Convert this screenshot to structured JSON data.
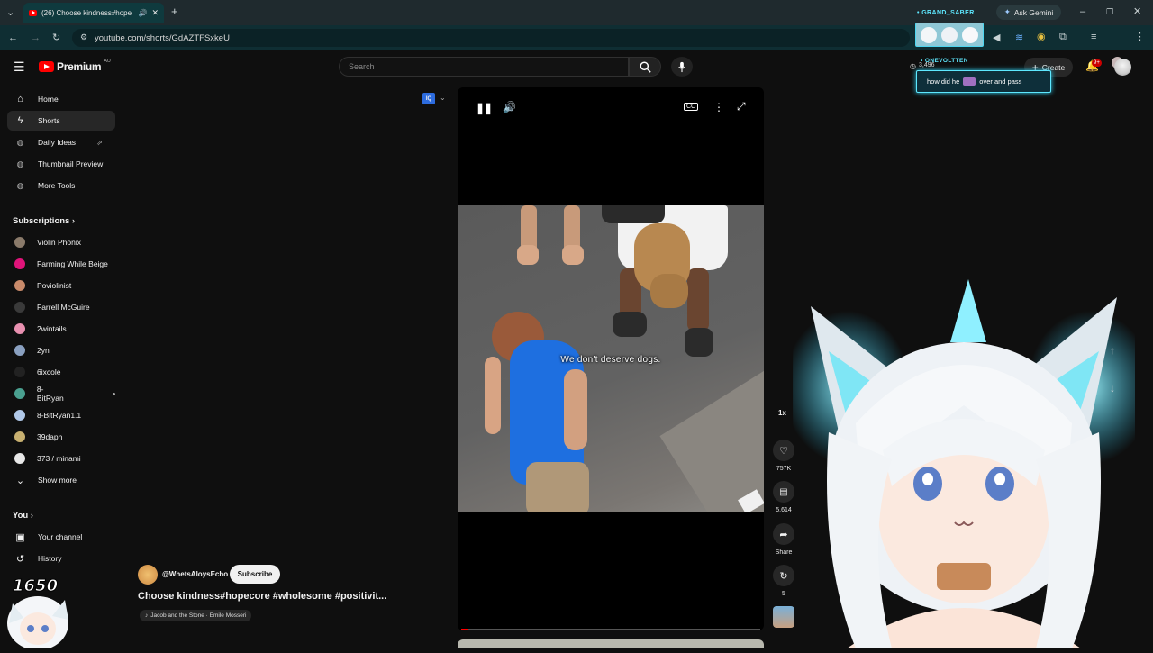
{
  "browser": {
    "tab_title": "(26) Choose kindness#hope",
    "url": "youtube.com/shorts/GdAZTFSxkeU",
    "ask_gemini": "Ask Gemini"
  },
  "header": {
    "logo_text": "Premium",
    "logo_region": "AU",
    "search_placeholder": "Search",
    "create_label": "Create",
    "notif_badge": "9+",
    "overlay_counter": "3,496"
  },
  "sidebar": {
    "nav": [
      {
        "label": "Home",
        "icon": "home-icon",
        "active": false
      },
      {
        "label": "Shorts",
        "icon": "shorts-icon",
        "active": true
      },
      {
        "label": "Daily Ideas",
        "icon": "extension-icon",
        "active": false
      },
      {
        "label": "Thumbnail Preview",
        "icon": "extension-icon",
        "active": false
      },
      {
        "label": "More Tools",
        "icon": "extension-icon",
        "active": false
      }
    ],
    "subscriptions_title": "Subscriptions",
    "subscriptions": [
      {
        "label": "Violin Phonix",
        "color": "#8a7a6a"
      },
      {
        "label": "Farming While Beige",
        "color": "#e0147a"
      },
      {
        "label": "Poviolinist",
        "color": "#c98a6a"
      },
      {
        "label": "Farrell McGuire",
        "color": "#3a3a3a"
      },
      {
        "label": "2wintails",
        "color": "#e890b0"
      },
      {
        "label": "2yn",
        "color": "#8aa0c0"
      },
      {
        "label": "6ixcole",
        "color": "#222222"
      },
      {
        "label": "8-BitRyan",
        "color": "#4aa090"
      },
      {
        "label": "8-BitRyan1.1",
        "color": "#b0c8e8"
      },
      {
        "label": "39daph",
        "color": "#c8b070"
      },
      {
        "label": "373 / minami",
        "color": "#e8e8e8"
      }
    ],
    "show_more": "Show more",
    "you_title": "You",
    "you_items": [
      {
        "label": "Your channel",
        "icon": "user-square-icon"
      },
      {
        "label": "History",
        "icon": "history-icon"
      }
    ]
  },
  "video": {
    "caption": "We don't deserve dogs.",
    "progress_fraction": 0.02
  },
  "actions": {
    "speed": "1x",
    "likes": "757K",
    "comments": "5,614",
    "share": "Share",
    "remix": "5"
  },
  "channel": {
    "handle": "@WhetsAloysEcho",
    "subscribe": "Subscribe",
    "title": "Choose kindness#hopecore #wholesome #positivit...",
    "music": "Jacob and the Stone · Emile Mosseri"
  },
  "overlay": {
    "grand_saber": "GRAND_SABER",
    "onevoltten": "ONEVOLTTEN",
    "chat_message_pre": "how did he",
    "chat_message_post": "over and pass",
    "sub_count": "1650"
  },
  "colors": {
    "background": "#0f0f0f",
    "accent_red": "#ff0000",
    "overlay_cyan": "#5ee8ff"
  }
}
